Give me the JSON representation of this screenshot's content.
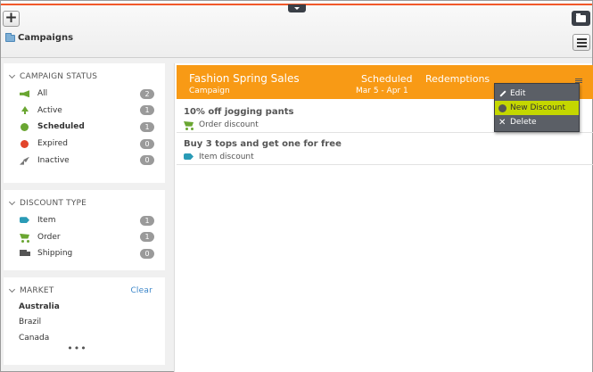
{
  "toolbar": {
    "add_label": "+",
    "breadcrumb": "Campaigns"
  },
  "sidebar": {
    "campaign_status": {
      "title": "CAMPAIGN STATUS",
      "items": [
        {
          "label": "All",
          "count": "2",
          "icon": "megaphone-icon"
        },
        {
          "label": "Active",
          "count": "1",
          "icon": "arrow-up-icon"
        },
        {
          "label": "Scheduled",
          "count": "1",
          "icon": "clock-icon",
          "selected": true
        },
        {
          "label": "Expired",
          "count": "0",
          "icon": "expired-icon"
        },
        {
          "label": "Inactive",
          "count": "0",
          "icon": "rocket-icon"
        }
      ]
    },
    "discount_type": {
      "title": "DISCOUNT TYPE",
      "items": [
        {
          "label": "Item",
          "count": "1",
          "icon": "tag-icon"
        },
        {
          "label": "Order",
          "count": "1",
          "icon": "cart-icon"
        },
        {
          "label": "Shipping",
          "count": "0",
          "icon": "truck-icon"
        }
      ]
    },
    "market": {
      "title": "MARKET",
      "clear_label": "Clear",
      "items": [
        {
          "label": "Australia",
          "selected": true
        },
        {
          "label": "Brazil"
        },
        {
          "label": "Canada"
        }
      ],
      "more_label": "•••"
    }
  },
  "campaign": {
    "name": "Fashion Spring Sales",
    "type": "Campaign",
    "status": "Scheduled",
    "dates": "Mar 5 - Apr 1",
    "redemptions_label": "Redemptions",
    "color": "#f89a15"
  },
  "discounts": [
    {
      "title": "10% off jogging pants",
      "type": "Order discount",
      "icon": "cart-icon"
    },
    {
      "title": "Buy 3 tops and get one for free",
      "type": "Item discount",
      "icon": "tag-icon"
    }
  ],
  "context_menu": {
    "items": [
      {
        "label": "Edit",
        "icon": "pencil-icon"
      },
      {
        "label": "New Discount",
        "icon": "circle-icon",
        "highlighted": true
      },
      {
        "label": "Delete",
        "icon": "x-icon"
      }
    ],
    "highlight_color": "#c4d700"
  },
  "colors": {
    "accent_line": "#f1592a",
    "badge": "#9a9a9a",
    "link": "#3b86c9"
  }
}
